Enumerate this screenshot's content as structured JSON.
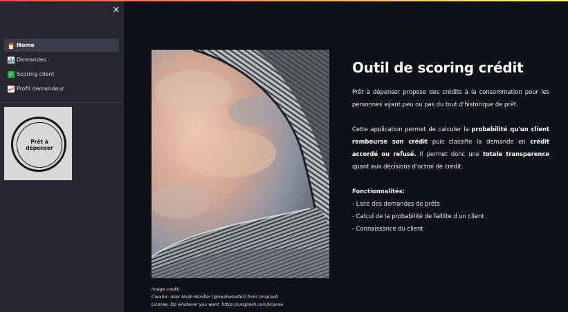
{
  "sidebar": {
    "close_label": "×",
    "nav": [
      {
        "label": "Home",
        "icon": "home-icon",
        "active": true
      },
      {
        "label": "Demandes",
        "icon": "bar-chart-icon",
        "active": false
      },
      {
        "label": "Scoring client",
        "icon": "check-icon",
        "active": false
      },
      {
        "label": "Profil demandeur",
        "icon": "chart-increasing-icon",
        "active": false
      }
    ],
    "logo_text": "Prêt à dépenser"
  },
  "main": {
    "title": "Outil de scoring crédit",
    "intro": "Prêt à dépenser propose des crédits à la consommation pour les personnes ayant peu ou pas du tout d'historique de prêt.",
    "description": {
      "t1": "Cette application permet de calculer la ",
      "b1": "probabilité qu'un client rembourse son crédit",
      "t2": " puis classifie la demande en ",
      "b2": "crédit accordé ou refusé.",
      "t3": " Il permet donc une ",
      "b3": "totale transparence",
      "t4": " quant aux décisions d'octroi de crédit."
    },
    "features_title": "Fonctionnalités:",
    "features": [
      "- Liste des demandes de prêts",
      "- Calcul de la probabilité de faillite d un client",
      "- Connaissance du client"
    ],
    "image_credit": [
      "Image credit:",
      "Creator: User Noah Windler (@noahwindler) from Unsplash",
      "License: Do whatever you want. https://unsplash.com/license"
    ]
  },
  "colors": {
    "background": "#0e1117",
    "sidebar": "#262730",
    "active_item": "#3b3d4a",
    "accent_gradient_start": "#ff4b4b",
    "accent_gradient_end": "#fffd80"
  }
}
